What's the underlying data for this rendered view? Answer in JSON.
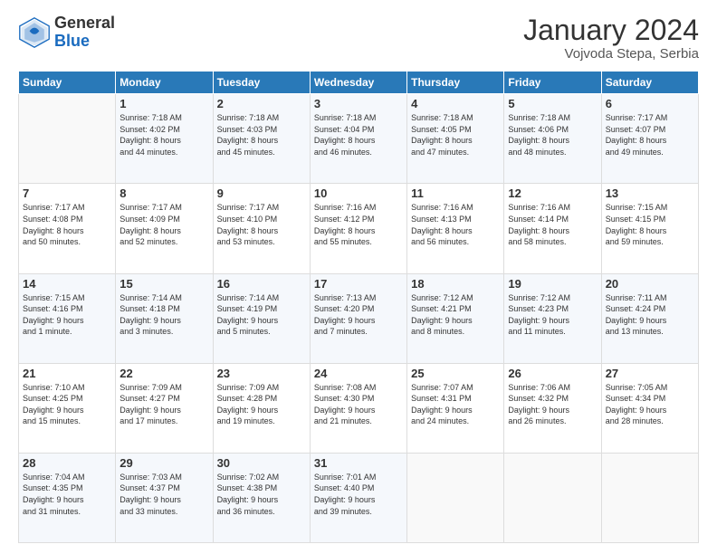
{
  "logo": {
    "general": "General",
    "blue": "Blue"
  },
  "header": {
    "month": "January 2024",
    "location": "Vojvoda Stepa, Serbia"
  },
  "weekdays": [
    "Sunday",
    "Monday",
    "Tuesday",
    "Wednesday",
    "Thursday",
    "Friday",
    "Saturday"
  ],
  "weeks": [
    [
      {
        "day": "",
        "info": ""
      },
      {
        "day": "1",
        "info": "Sunrise: 7:18 AM\nSunset: 4:02 PM\nDaylight: 8 hours\nand 44 minutes."
      },
      {
        "day": "2",
        "info": "Sunrise: 7:18 AM\nSunset: 4:03 PM\nDaylight: 8 hours\nand 45 minutes."
      },
      {
        "day": "3",
        "info": "Sunrise: 7:18 AM\nSunset: 4:04 PM\nDaylight: 8 hours\nand 46 minutes."
      },
      {
        "day": "4",
        "info": "Sunrise: 7:18 AM\nSunset: 4:05 PM\nDaylight: 8 hours\nand 47 minutes."
      },
      {
        "day": "5",
        "info": "Sunrise: 7:18 AM\nSunset: 4:06 PM\nDaylight: 8 hours\nand 48 minutes."
      },
      {
        "day": "6",
        "info": "Sunrise: 7:17 AM\nSunset: 4:07 PM\nDaylight: 8 hours\nand 49 minutes."
      }
    ],
    [
      {
        "day": "7",
        "info": "Sunrise: 7:17 AM\nSunset: 4:08 PM\nDaylight: 8 hours\nand 50 minutes."
      },
      {
        "day": "8",
        "info": "Sunrise: 7:17 AM\nSunset: 4:09 PM\nDaylight: 8 hours\nand 52 minutes."
      },
      {
        "day": "9",
        "info": "Sunrise: 7:17 AM\nSunset: 4:10 PM\nDaylight: 8 hours\nand 53 minutes."
      },
      {
        "day": "10",
        "info": "Sunrise: 7:16 AM\nSunset: 4:12 PM\nDaylight: 8 hours\nand 55 minutes."
      },
      {
        "day": "11",
        "info": "Sunrise: 7:16 AM\nSunset: 4:13 PM\nDaylight: 8 hours\nand 56 minutes."
      },
      {
        "day": "12",
        "info": "Sunrise: 7:16 AM\nSunset: 4:14 PM\nDaylight: 8 hours\nand 58 minutes."
      },
      {
        "day": "13",
        "info": "Sunrise: 7:15 AM\nSunset: 4:15 PM\nDaylight: 8 hours\nand 59 minutes."
      }
    ],
    [
      {
        "day": "14",
        "info": "Sunrise: 7:15 AM\nSunset: 4:16 PM\nDaylight: 9 hours\nand 1 minute."
      },
      {
        "day": "15",
        "info": "Sunrise: 7:14 AM\nSunset: 4:18 PM\nDaylight: 9 hours\nand 3 minutes."
      },
      {
        "day": "16",
        "info": "Sunrise: 7:14 AM\nSunset: 4:19 PM\nDaylight: 9 hours\nand 5 minutes."
      },
      {
        "day": "17",
        "info": "Sunrise: 7:13 AM\nSunset: 4:20 PM\nDaylight: 9 hours\nand 7 minutes."
      },
      {
        "day": "18",
        "info": "Sunrise: 7:12 AM\nSunset: 4:21 PM\nDaylight: 9 hours\nand 8 minutes."
      },
      {
        "day": "19",
        "info": "Sunrise: 7:12 AM\nSunset: 4:23 PM\nDaylight: 9 hours\nand 11 minutes."
      },
      {
        "day": "20",
        "info": "Sunrise: 7:11 AM\nSunset: 4:24 PM\nDaylight: 9 hours\nand 13 minutes."
      }
    ],
    [
      {
        "day": "21",
        "info": "Sunrise: 7:10 AM\nSunset: 4:25 PM\nDaylight: 9 hours\nand 15 minutes."
      },
      {
        "day": "22",
        "info": "Sunrise: 7:09 AM\nSunset: 4:27 PM\nDaylight: 9 hours\nand 17 minutes."
      },
      {
        "day": "23",
        "info": "Sunrise: 7:09 AM\nSunset: 4:28 PM\nDaylight: 9 hours\nand 19 minutes."
      },
      {
        "day": "24",
        "info": "Sunrise: 7:08 AM\nSunset: 4:30 PM\nDaylight: 9 hours\nand 21 minutes."
      },
      {
        "day": "25",
        "info": "Sunrise: 7:07 AM\nSunset: 4:31 PM\nDaylight: 9 hours\nand 24 minutes."
      },
      {
        "day": "26",
        "info": "Sunrise: 7:06 AM\nSunset: 4:32 PM\nDaylight: 9 hours\nand 26 minutes."
      },
      {
        "day": "27",
        "info": "Sunrise: 7:05 AM\nSunset: 4:34 PM\nDaylight: 9 hours\nand 28 minutes."
      }
    ],
    [
      {
        "day": "28",
        "info": "Sunrise: 7:04 AM\nSunset: 4:35 PM\nDaylight: 9 hours\nand 31 minutes."
      },
      {
        "day": "29",
        "info": "Sunrise: 7:03 AM\nSunset: 4:37 PM\nDaylight: 9 hours\nand 33 minutes."
      },
      {
        "day": "30",
        "info": "Sunrise: 7:02 AM\nSunset: 4:38 PM\nDaylight: 9 hours\nand 36 minutes."
      },
      {
        "day": "31",
        "info": "Sunrise: 7:01 AM\nSunset: 4:40 PM\nDaylight: 9 hours\nand 39 minutes."
      },
      {
        "day": "",
        "info": ""
      },
      {
        "day": "",
        "info": ""
      },
      {
        "day": "",
        "info": ""
      }
    ]
  ]
}
